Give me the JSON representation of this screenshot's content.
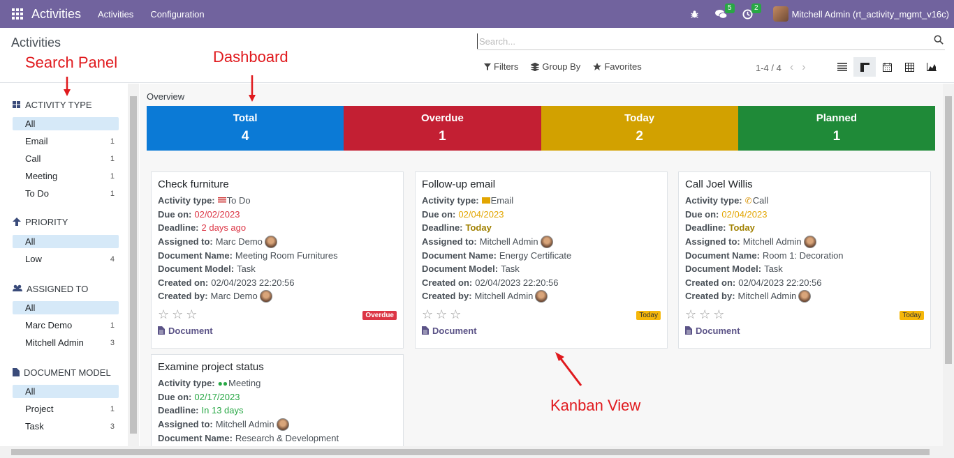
{
  "navbar": {
    "brand": "Activities",
    "menus": [
      "Activities",
      "Configuration"
    ],
    "chat_count": "5",
    "activity_count": "2",
    "user": "Mitchell Admin (rt_activity_mgmt_v16c)"
  },
  "control": {
    "breadcrumb": "Activities",
    "search_placeholder": "Search...",
    "filters": "Filters",
    "group_by": "Group By",
    "favorites": "Favorites",
    "pager": "1-4 / 4"
  },
  "search_panel": {
    "activity_type": {
      "header": "ACTIVITY TYPE",
      "items": [
        {
          "label": "All",
          "count": ""
        },
        {
          "label": "Email",
          "count": "1"
        },
        {
          "label": "Call",
          "count": "1"
        },
        {
          "label": "Meeting",
          "count": "1"
        },
        {
          "label": "To Do",
          "count": "1"
        }
      ]
    },
    "priority": {
      "header": "PRIORITY",
      "items": [
        {
          "label": "All",
          "count": ""
        },
        {
          "label": "Low",
          "count": "4"
        }
      ]
    },
    "assigned_to": {
      "header": "ASSIGNED TO",
      "items": [
        {
          "label": "All",
          "count": ""
        },
        {
          "label": "Marc Demo",
          "count": "1"
        },
        {
          "label": "Mitchell Admin",
          "count": "3"
        }
      ]
    },
    "document_model": {
      "header": "DOCUMENT MODEL",
      "items": [
        {
          "label": "All",
          "count": ""
        },
        {
          "label": "Project",
          "count": "1"
        },
        {
          "label": "Task",
          "count": "3"
        }
      ]
    }
  },
  "overview": {
    "title": "Overview",
    "cells": [
      {
        "label": "Total",
        "value": "4",
        "color": "#0b7ad6"
      },
      {
        "label": "Overdue",
        "value": "1",
        "color": "#c31f33"
      },
      {
        "label": "Today",
        "value": "2",
        "color": "#d2a100"
      },
      {
        "label": "Planned",
        "value": "1",
        "color": "#1f8a38"
      }
    ]
  },
  "labels": {
    "activity_type": "Activity type:",
    "due_on": "Due on:",
    "deadline": "Deadline:",
    "assigned_to": "Assigned to:",
    "document_name": "Document Name:",
    "document_model": "Document Model:",
    "created_on": "Created on:",
    "created_by": "Created by:",
    "document": "Document"
  },
  "cards": [
    {
      "title": "Check furniture",
      "type": "To Do",
      "due": "02/02/2023",
      "deadline": "2 days ago",
      "assigned": "Marc Demo",
      "doc_name": "Meeting Room Furnitures",
      "doc_model": "Task",
      "created_on": "02/04/2023 22:20:56",
      "created_by": "Marc Demo",
      "tag": "Overdue"
    },
    {
      "title": "Follow-up email",
      "type": "Email",
      "due": "02/04/2023",
      "deadline": "Today",
      "assigned": "Mitchell Admin",
      "doc_name": "Energy Certificate",
      "doc_model": "Task",
      "created_on": "02/04/2023 22:20:56",
      "created_by": "Mitchell Admin",
      "tag": "Today"
    },
    {
      "title": "Call Joel Willis",
      "type": "Call",
      "due": "02/04/2023",
      "deadline": "Today",
      "assigned": "Mitchell Admin",
      "doc_name": "Room 1: Decoration",
      "doc_model": "Task",
      "created_on": "02/04/2023 22:20:56",
      "created_by": "Mitchell Admin",
      "tag": "Today"
    },
    {
      "title": "Examine project status",
      "type": "Meeting",
      "due": "02/17/2023",
      "deadline": "In 13 days",
      "assigned": "Mitchell Admin",
      "doc_name": "Research & Development"
    }
  ],
  "annotations": {
    "search_panel": "Search Panel",
    "dashboard": "Dashboard",
    "kanban": "Kanban View"
  }
}
